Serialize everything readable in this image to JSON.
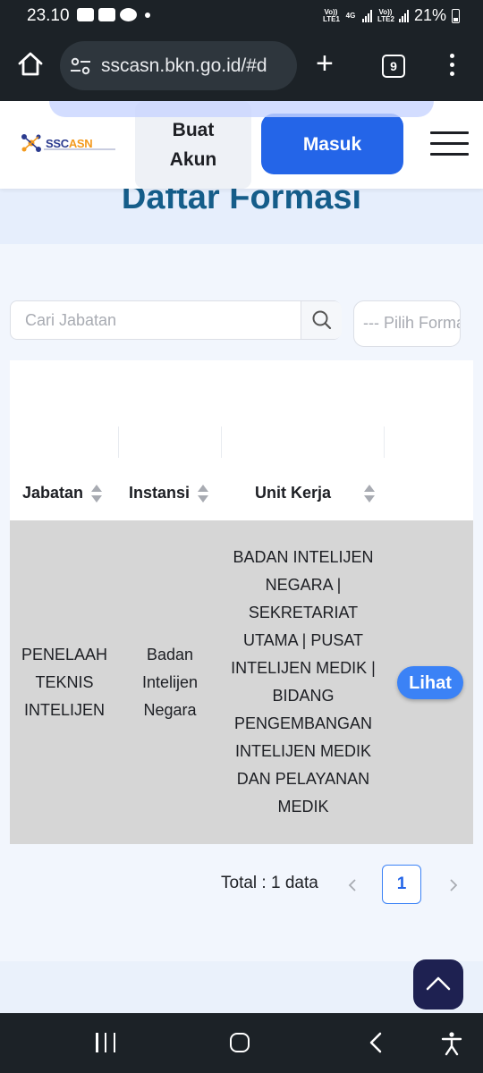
{
  "status_bar": {
    "time": "23.10",
    "net1": "Vo)) LTE1",
    "net_type": "4G",
    "net2": "Vo)) LTE2",
    "battery": "21%"
  },
  "browser": {
    "url": "sscasn.bkn.go.id/#d",
    "tab_count": "9"
  },
  "header": {
    "logo_text_a": "SSC",
    "logo_text_b": "ASN",
    "buat_akun_line1": "Buat",
    "buat_akun_line2": "Akun",
    "masuk_label": "Masuk"
  },
  "main": {
    "title": "Daftar Formasi",
    "search_placeholder": "Cari Jabatan",
    "select_placeholder": "--- Pilih Formasi ---"
  },
  "table": {
    "columns": [
      "Jabatan",
      "Instansi",
      "Unit Kerja"
    ],
    "rows": [
      {
        "jabatan": "PENELAAH TEKNIS INTELIJEN",
        "instansi": "Badan Intelijen Negara",
        "unit_kerja": "BADAN INTELIJEN NEGARA | SEKRETARIAT UTAMA | PUSAT INTELIJEN MEDIK | BIDANG PENGEMBANGAN INTELIJEN MEDIK DAN PELAYANAN MEDIK",
        "action": "Lihat"
      }
    ]
  },
  "pagination": {
    "total": "Total : 1 data",
    "current_page": "1"
  },
  "icons": {
    "home": "home-icon",
    "site_settings": "tune-icon",
    "search": "search-icon",
    "scroll_top": "chevron-up-icon"
  },
  "colors": {
    "primary": "#2465e8",
    "title": "#155d8a",
    "row_bg": "#d6d6d6",
    "scroll_top_bg": "#1e2151"
  }
}
